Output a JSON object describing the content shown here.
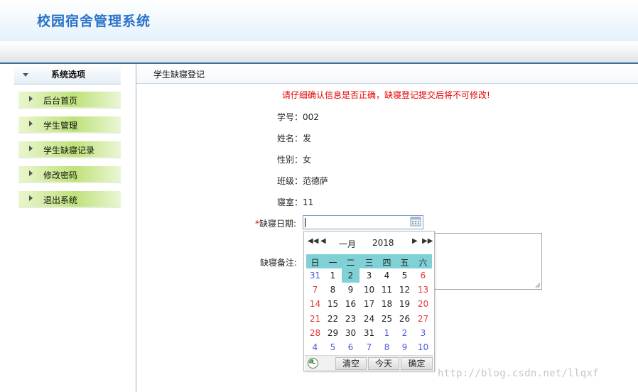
{
  "header": {
    "title": "校园宿舍管理系统"
  },
  "sidebar": {
    "heading": "系统选项",
    "items": [
      {
        "label": "后台首页"
      },
      {
        "label": "学生管理"
      },
      {
        "label": "学生缺寝记录"
      },
      {
        "label": "修改密码"
      },
      {
        "label": "退出系统"
      }
    ]
  },
  "content": {
    "title": "学生缺寝登记",
    "warning": "请仔细确认信息是否正确，缺寝登记提交后将不可修改!",
    "fields": {
      "student_id": "学号：002",
      "name": "姓名：发",
      "gender": "性别：女",
      "class": "班级：范德萨",
      "dorm": "寝室：11",
      "date_required_mark": "*",
      "date_label": "缺寝日期:",
      "date_value": "",
      "remark_label": "缺寝备注:",
      "remark_value": ""
    }
  },
  "calendar": {
    "nav": {
      "prev_year": "◀◀",
      "prev_month": "◀",
      "next_month": "▶",
      "next_year": "▶▶"
    },
    "month": "一月",
    "year": "2018",
    "weekdays": [
      "日",
      "一",
      "二",
      "三",
      "四",
      "五",
      "六"
    ],
    "weeks": [
      [
        "31",
        "1",
        "2",
        "3",
        "4",
        "5",
        "6"
      ],
      [
        "7",
        "8",
        "9",
        "10",
        "11",
        "12",
        "13"
      ],
      [
        "14",
        "15",
        "16",
        "17",
        "18",
        "19",
        "20"
      ],
      [
        "21",
        "22",
        "23",
        "24",
        "25",
        "26",
        "27"
      ],
      [
        "28",
        "29",
        "30",
        "31",
        "1",
        "2",
        "3"
      ],
      [
        "4",
        "5",
        "6",
        "7",
        "8",
        "9",
        "10"
      ]
    ],
    "selected_day": "2",
    "buttons": {
      "clear": "清空",
      "today": "今天",
      "confirm": "确定"
    },
    "colors": {
      "weekday_header_bg": "#7fd1d6",
      "weekend_text": "#e0393b",
      "other_month_text": "#4c5bd5"
    }
  },
  "watermark": "http://blog.csdn.net/llqxf"
}
